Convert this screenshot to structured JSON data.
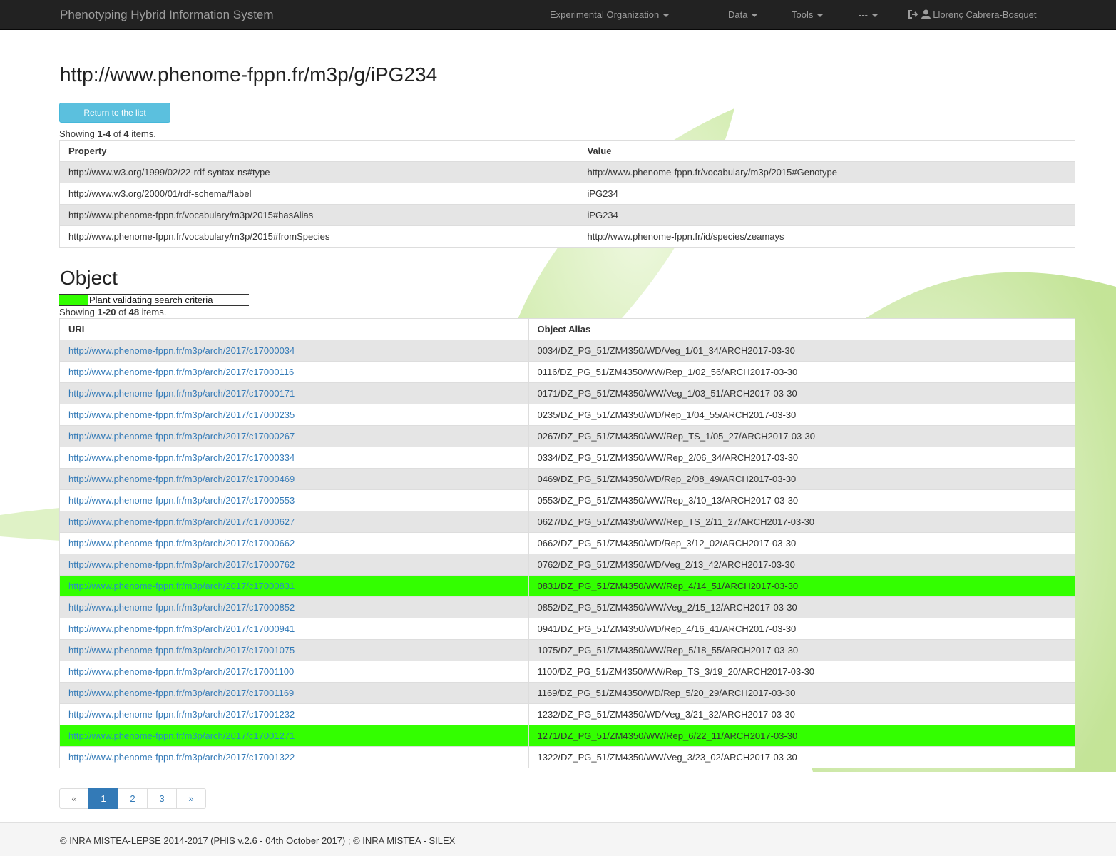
{
  "navbar": {
    "brand": "Phenotyping Hybrid Information System",
    "menu": {
      "experimental": "Experimental Organization",
      "data": "Data",
      "tools": "Tools",
      "misc": "---",
      "user": "Llorenç Cabrera-Bosquet"
    },
    "icons": {
      "logout": "logout-icon",
      "user": "user-icon"
    }
  },
  "page": {
    "title": "http://www.phenome-fppn.fr/m3p/g/iPG234",
    "return_button": "Return to the list"
  },
  "properties": {
    "summary": {
      "prefix": "Showing ",
      "range": "1-4",
      "mid": " of ",
      "total": "4",
      "suffix": " items."
    },
    "headers": {
      "property": "Property",
      "value": "Value"
    },
    "rows": [
      {
        "property": "http://www.w3.org/1999/02/22-rdf-syntax-ns#type",
        "value": "http://www.phenome-fppn.fr/vocabulary/m3p/2015#Genotype"
      },
      {
        "property": "http://www.w3.org/2000/01/rdf-schema#label",
        "value": "iPG234"
      },
      {
        "property": "http://www.phenome-fppn.fr/vocabulary/m3p/2015#hasAlias",
        "value": "iPG234"
      },
      {
        "property": "http://www.phenome-fppn.fr/vocabulary/m3p/2015#fromSpecies",
        "value": "http://www.phenome-fppn.fr/id/species/zeamays"
      }
    ]
  },
  "objects": {
    "title": "Object",
    "legend": "Plant validating search criteria",
    "highlight_color": "#33ff00",
    "summary": {
      "prefix": "Showing ",
      "range": "1-20",
      "mid": " of ",
      "total": "48",
      "suffix": " items."
    },
    "headers": {
      "uri": "URI",
      "alias": "Object Alias"
    },
    "rows": [
      {
        "uri": "http://www.phenome-fppn.fr/m3p/arch/2017/c17000034",
        "alias": "0034/DZ_PG_51/ZM4350/WD/Veg_1/01_34/ARCH2017-03-30"
      },
      {
        "uri": "http://www.phenome-fppn.fr/m3p/arch/2017/c17000116",
        "alias": "0116/DZ_PG_51/ZM4350/WW/Rep_1/02_56/ARCH2017-03-30"
      },
      {
        "uri": "http://www.phenome-fppn.fr/m3p/arch/2017/c17000171",
        "alias": "0171/DZ_PG_51/ZM4350/WW/Veg_1/03_51/ARCH2017-03-30"
      },
      {
        "uri": "http://www.phenome-fppn.fr/m3p/arch/2017/c17000235",
        "alias": "0235/DZ_PG_51/ZM4350/WD/Rep_1/04_55/ARCH2017-03-30"
      },
      {
        "uri": "http://www.phenome-fppn.fr/m3p/arch/2017/c17000267",
        "alias": "0267/DZ_PG_51/ZM4350/WW/Rep_TS_1/05_27/ARCH2017-03-30"
      },
      {
        "uri": "http://www.phenome-fppn.fr/m3p/arch/2017/c17000334",
        "alias": "0334/DZ_PG_51/ZM4350/WW/Rep_2/06_34/ARCH2017-03-30"
      },
      {
        "uri": "http://www.phenome-fppn.fr/m3p/arch/2017/c17000469",
        "alias": "0469/DZ_PG_51/ZM4350/WD/Rep_2/08_49/ARCH2017-03-30"
      },
      {
        "uri": "http://www.phenome-fppn.fr/m3p/arch/2017/c17000553",
        "alias": "0553/DZ_PG_51/ZM4350/WW/Rep_3/10_13/ARCH2017-03-30"
      },
      {
        "uri": "http://www.phenome-fppn.fr/m3p/arch/2017/c17000627",
        "alias": "0627/DZ_PG_51/ZM4350/WW/Rep_TS_2/11_27/ARCH2017-03-30"
      },
      {
        "uri": "http://www.phenome-fppn.fr/m3p/arch/2017/c17000662",
        "alias": "0662/DZ_PG_51/ZM4350/WD/Rep_3/12_02/ARCH2017-03-30"
      },
      {
        "uri": "http://www.phenome-fppn.fr/m3p/arch/2017/c17000762",
        "alias": "0762/DZ_PG_51/ZM4350/WD/Veg_2/13_42/ARCH2017-03-30"
      },
      {
        "uri": "http://www.phenome-fppn.fr/m3p/arch/2017/c17000831",
        "alias": "0831/DZ_PG_51/ZM4350/WW/Rep_4/14_51/ARCH2017-03-30",
        "highlight": true
      },
      {
        "uri": "http://www.phenome-fppn.fr/m3p/arch/2017/c17000852",
        "alias": "0852/DZ_PG_51/ZM4350/WW/Veg_2/15_12/ARCH2017-03-30"
      },
      {
        "uri": "http://www.phenome-fppn.fr/m3p/arch/2017/c17000941",
        "alias": "0941/DZ_PG_51/ZM4350/WD/Rep_4/16_41/ARCH2017-03-30"
      },
      {
        "uri": "http://www.phenome-fppn.fr/m3p/arch/2017/c17001075",
        "alias": "1075/DZ_PG_51/ZM4350/WW/Rep_5/18_55/ARCH2017-03-30"
      },
      {
        "uri": "http://www.phenome-fppn.fr/m3p/arch/2017/c17001100",
        "alias": "1100/DZ_PG_51/ZM4350/WW/Rep_TS_3/19_20/ARCH2017-03-30"
      },
      {
        "uri": "http://www.phenome-fppn.fr/m3p/arch/2017/c17001169",
        "alias": "1169/DZ_PG_51/ZM4350/WD/Rep_5/20_29/ARCH2017-03-30"
      },
      {
        "uri": "http://www.phenome-fppn.fr/m3p/arch/2017/c17001232",
        "alias": "1232/DZ_PG_51/ZM4350/WD/Veg_3/21_32/ARCH2017-03-30"
      },
      {
        "uri": "http://www.phenome-fppn.fr/m3p/arch/2017/c17001271",
        "alias": "1271/DZ_PG_51/ZM4350/WW/Rep_6/22_11/ARCH2017-03-30",
        "highlight": true
      },
      {
        "uri": "http://www.phenome-fppn.fr/m3p/arch/2017/c17001322",
        "alias": "1322/DZ_PG_51/ZM4350/WW/Veg_3/23_02/ARCH2017-03-30"
      }
    ]
  },
  "pagination": {
    "prev": "«",
    "pages": [
      "1",
      "2",
      "3"
    ],
    "active": "1",
    "next": "»"
  },
  "footer": {
    "text": "© INRA MISTEA-LEPSE 2014-2017 (PHIS v.2.6 - 04th October 2017) ; © INRA MISTEA - SILEX"
  }
}
